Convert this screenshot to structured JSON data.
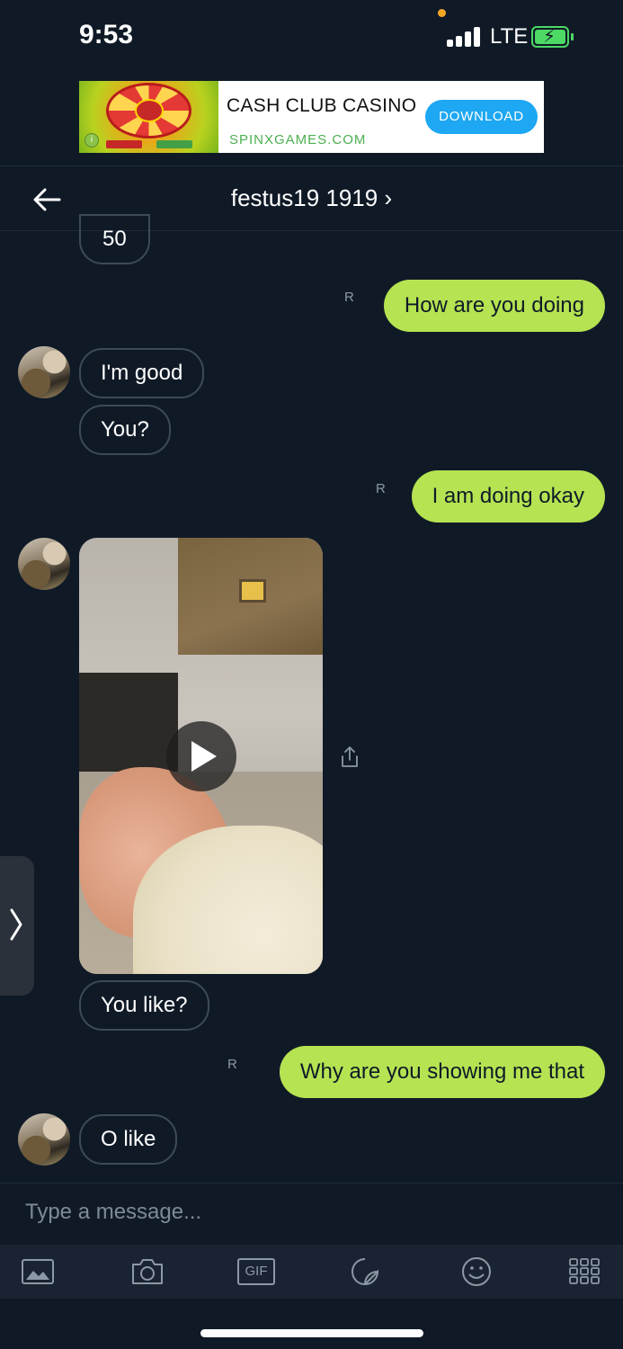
{
  "status_bar": {
    "time": "9:53",
    "network": "LTE"
  },
  "ad": {
    "title": "CASH CLUB CASINO",
    "subtitle": "SPINXGAMES.COM",
    "cta": "DOWNLOAD"
  },
  "header": {
    "title": "festus19 1919 ›"
  },
  "messages": {
    "m0": "50",
    "m1": "How are you doing",
    "m2": "I'm good",
    "m3": "You?",
    "m4": "I am doing okay",
    "m5": "You like?",
    "m6": "Why are you showing me that",
    "m7": "O like"
  },
  "receipt_mark": "R",
  "compose": {
    "placeholder": "Type a message..."
  },
  "toolbar": {
    "gif_label": "GIF"
  },
  "icons": {
    "back": "arrow-left-icon",
    "play": "play-icon",
    "share": "share-icon",
    "side": "chevron-right-icon",
    "toolbar": [
      "image-icon",
      "camera-icon",
      "gif-icon",
      "sticker-icon",
      "emoji-icon",
      "grid-icon"
    ]
  },
  "colors": {
    "background": "#101a27",
    "outgoing_bubble": "#b5e352",
    "incoming_border": "#3d4a5a",
    "ad_cta": "#1ea7f2",
    "battery": "#4cd964"
  }
}
